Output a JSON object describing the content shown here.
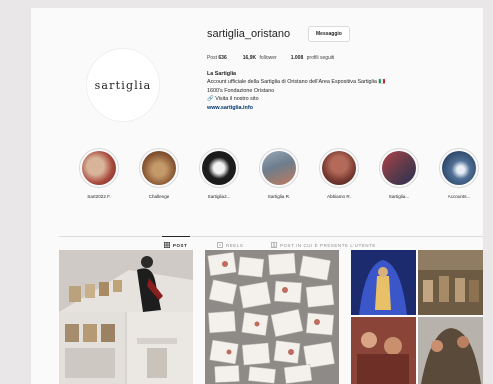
{
  "profile": {
    "username": "sartiglia_oristano",
    "message_button": "Messaggio",
    "avatar_logo": "sartiglia",
    "stats": [
      {
        "value": "636",
        "label": "Post"
      },
      {
        "value": "16,9K",
        "label": "follower"
      },
      {
        "value": "1.008",
        "label": "profili seguiti"
      }
    ],
    "bio": {
      "name": "La Sartiglia",
      "line1": "Account ufficiale della Sartiglia di Oristano dell'Area Espositiva Sartiglia",
      "line2": "1600's Fondazione Oristano",
      "line3": "Visita il nostro sito",
      "link": "www.sartiglia.info"
    }
  },
  "highlights": [
    {
      "label": "Sart2022 F.",
      "color": "#a9493d"
    },
    {
      "label": "Challenge",
      "color": "#8b5a36"
    },
    {
      "label": "Sartiglia2...",
      "color": "#1c1c1c"
    },
    {
      "label": "Sartiglia R.",
      "color": "#6d7d8d"
    },
    {
      "label": "Abbiamo R.",
      "color": "#7a3b33"
    },
    {
      "label": "Sartiglia...",
      "color": "#5c3a4a"
    },
    {
      "label": "Accounts...",
      "color": "#2f4a6b"
    }
  ],
  "tabs": [
    {
      "label": "POST",
      "icon": "grid-icon",
      "active": true
    },
    {
      "label": "REELS",
      "icon": "reels-icon",
      "active": false
    },
    {
      "label": "POST IN CUI È PRESENTE L'UTENTE",
      "icon": "tagged-icon",
      "active": false
    }
  ],
  "colors": {
    "background": "#e9e7e8",
    "page": "#fafafa",
    "border": "#dbdbdb",
    "link": "#00376b"
  }
}
